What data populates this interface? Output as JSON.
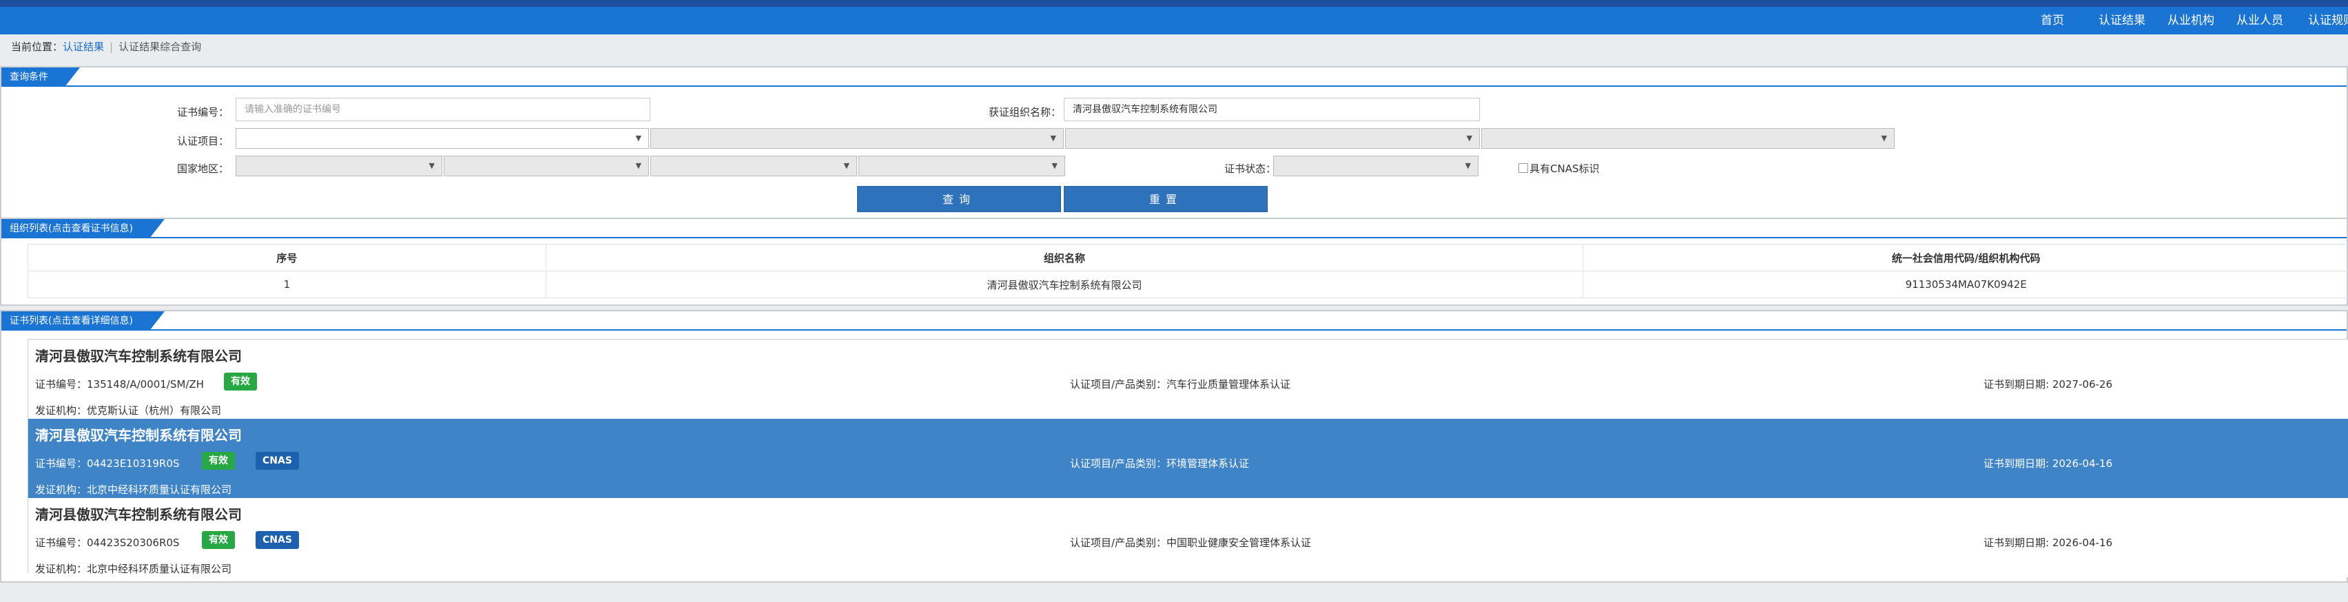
{
  "nav": {
    "items": [
      "首页",
      "认证结果",
      "从业机构",
      "从业人员",
      "认证规则"
    ]
  },
  "breadcrumb": {
    "prefix": "当前位置：",
    "link": "认证结果",
    "separator": "|",
    "current": "认证结果综合查询"
  },
  "query": {
    "tag": "查询条件",
    "cert_no_label": "证书编号：",
    "cert_no_placeholder": "请输入准确的证书编号",
    "org_name_label": "获证组织名称：",
    "org_name_value": "清河县傲驭汽车控制系统有限公司",
    "project_label": "认证项目：",
    "region_label": "国家地区：",
    "status_label": "证书状态：",
    "cnas_label": "具有CNAS标识",
    "query_button": "查询",
    "reset_button": "重置"
  },
  "org_list": {
    "tag": "组织列表(点击查看证书信息)",
    "columns": [
      "序号",
      "组织名称",
      "统一社会信用代码/组织机构代码"
    ],
    "rows": [
      [
        "1",
        "清河县傲驭汽车控制系统有限公司",
        "91130534MA07K0942E"
      ]
    ]
  },
  "cert_list": {
    "tag": "证书列表(点击查看详细信息)",
    "items": [
      {
        "name": "清河县傲驭汽车控制系统有限公司",
        "cert_no": "证书编号：135148/A/0001/SM/ZH",
        "status": "有效",
        "cnas": "",
        "project": "认证项目/产品类别：汽车行业质量管理体系认证",
        "expiry": "证书到期日期: 2027-06-26",
        "issuer": "发证机构：优克斯认证（杭州）有限公司"
      },
      {
        "name": "清河县傲驭汽车控制系统有限公司",
        "cert_no": "证书编号：04423E10319R0S",
        "status": "有效",
        "cnas": "CNAS",
        "project": "认证项目/产品类别：环境管理体系认证",
        "expiry": "证书到期日期: 2026-04-16",
        "issuer": "发证机构：北京中经科环质量认证有限公司"
      },
      {
        "name": "清河县傲驭汽车控制系统有限公司",
        "cert_no": "证书编号：04423S20306R0S",
        "status": "有效",
        "cnas": "CNAS",
        "project": "认证项目/产品类别：中国职业健康安全管理体系认证",
        "expiry": "证书到期日期: 2026-04-16",
        "issuer": "发证机构：北京中经科环质量认证有限公司"
      }
    ]
  },
  "colors": {
    "nav_bg": "#1a74d4",
    "accent": "#1a74d4",
    "highlight_row": "#3f84c7",
    "valid_badge": "#28a745",
    "cnas_badge": "#1d60ae"
  }
}
